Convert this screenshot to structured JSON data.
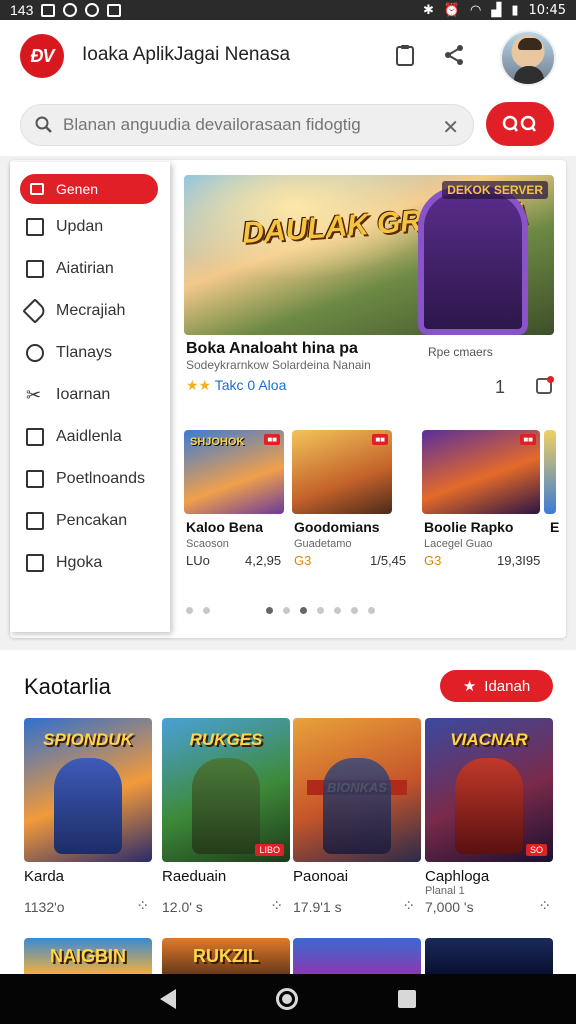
{
  "status_bar": {
    "time_left": "143",
    "time": "10:45"
  },
  "app": {
    "logo_text": "ÐV",
    "title": "Ioaka AplikJagai Nenasa"
  },
  "search": {
    "placeholder": "Blanan anguudia devailorasaan fidogtig"
  },
  "sidebar": {
    "items": [
      {
        "label": "Genen",
        "icon": "home-icon",
        "active": true
      },
      {
        "label": "Updan",
        "icon": "inbox-icon"
      },
      {
        "label": "Aiatirian",
        "icon": "checkbox-icon"
      },
      {
        "label": "Mecrajiah",
        "icon": "tag-icon"
      },
      {
        "label": "Tlanays",
        "icon": "eye-icon"
      },
      {
        "label": "Ioarnan",
        "icon": "tools-icon"
      },
      {
        "label": "Aaidlenla",
        "icon": "chart-icon"
      },
      {
        "label": "Poetlnoands",
        "icon": "square-icon"
      },
      {
        "label": "Pencakan",
        "icon": "square-icon"
      },
      {
        "label": "Hgoka",
        "icon": "square-icon"
      }
    ]
  },
  "featured": {
    "image_title": "DAULAK GRANDSA",
    "image_badge": "DEKOK SERVER",
    "title": "Boka Analoaht hina pa",
    "subtitle": "Sodeykrarnkow Solardeina Nanain",
    "side_text": "Rpe cmaers",
    "rating_text": "Takc 0 Aloa",
    "count": "1"
  },
  "mini_games": [
    {
      "image_title": "SHJOHOK",
      "name": "Kaloo Bena",
      "sub": "Scaoson",
      "price": "LUo",
      "value": "4,2,95"
    },
    {
      "image_title": "",
      "name": "Goodomians",
      "sub": "Guadetamo",
      "price": "G3",
      "value": "1/5,45"
    },
    {
      "image_title": "",
      "name": "Boolie Rapko",
      "sub": "Lacegel Guao",
      "price": "G3",
      "value": "19,3I95"
    },
    {
      "image_title": "",
      "name": "E",
      "sub": "",
      "price": "",
      "value": ""
    }
  ],
  "section": {
    "title": "Kaotarlia",
    "button_label": "Idanah",
    "cards": [
      {
        "image_title": "SPIONDUK",
        "name": "Karda",
        "sub": "",
        "value": "1132'o",
        "tag": ""
      },
      {
        "image_title": "RUKGES",
        "name": "Raeduain",
        "sub": "",
        "value": "12.0' s",
        "tag": "LIBO"
      },
      {
        "image_title": "BIONKAS",
        "name": "Paonoai",
        "sub": "",
        "value": "17.9'1 s",
        "tag": ""
      },
      {
        "image_title": "VIACNAR",
        "name": "Caphloga",
        "sub": "Planal 1",
        "value": "7,000 's",
        "tag": "SO"
      }
    ],
    "bottom_cards": [
      {
        "image_title": "NAIGBIN"
      },
      {
        "image_title": "RUKZIL"
      },
      {
        "image_title": ""
      },
      {
        "image_title": ""
      }
    ]
  },
  "colors": {
    "accent": "#e01f26",
    "link": "#1a6fd1",
    "star": "#f2b01e"
  }
}
